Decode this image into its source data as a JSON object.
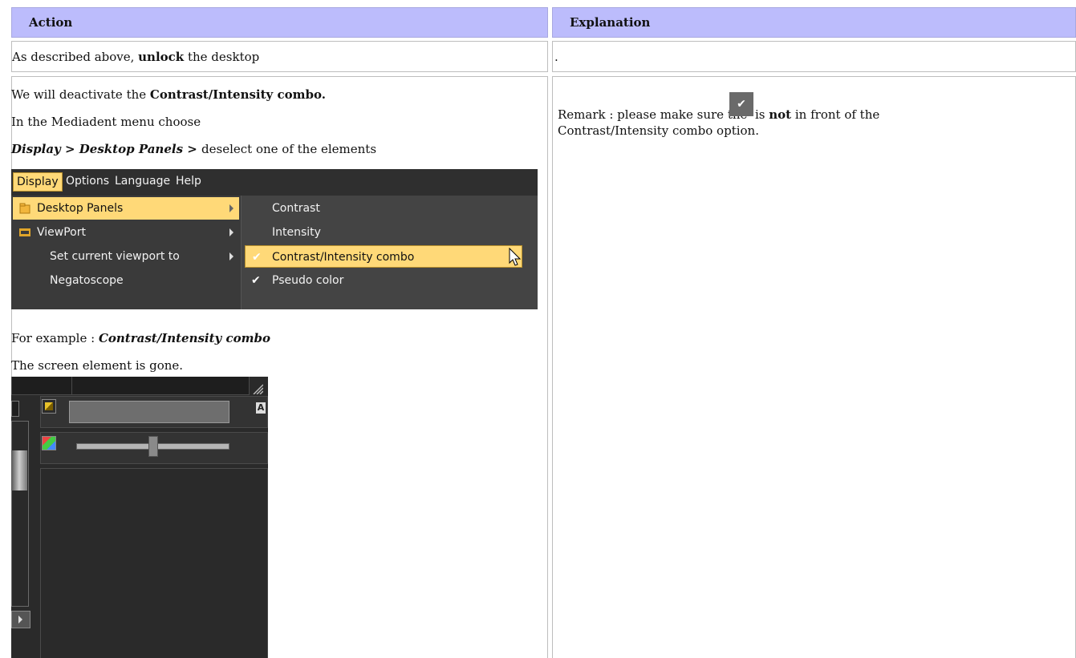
{
  "table": {
    "headers": {
      "action": "Action",
      "explanation": "Explanation"
    },
    "row1": {
      "action_pre": "As described above, ",
      "action_bold": "unlock",
      "action_post": " the desktop",
      "explanation": "."
    },
    "row2": {
      "line1_pre": "We will deactivate the ",
      "line1_bold": "Contrast/Intensity combo.",
      "line2": "In the Mediadent menu choose",
      "line3_a": "Display",
      "line3_sep1": " > ",
      "line3_b": "Desktop Panels",
      "line3_sep2": " > ",
      "line3_post": "deselect one of the elements",
      "example_pre": "For example : ",
      "example_bold": "Contrast/Intensity combo",
      "gone": "The screen element is gone.",
      "remark_pre": "Remark : please make sure the ",
      "remark_mid": " is ",
      "remark_bold": "not",
      "remark_post": " in front of the",
      "remark_line2": "Contrast/Intensity combo option."
    }
  },
  "menu": {
    "bar": [
      "Display",
      "Options",
      "Language",
      "Help"
    ],
    "left_items": [
      "Desktop Panels",
      "ViewPort",
      "Set current viewport to",
      "Negatoscope"
    ],
    "right_items": [
      "Contrast",
      "Intensity",
      "Contrast/Intensity combo",
      "Pseudo color"
    ],
    "checked": [
      false,
      false,
      true,
      true
    ],
    "highlight_color": "#ffd978"
  },
  "screen_element": {
    "letter_badge": "A"
  }
}
